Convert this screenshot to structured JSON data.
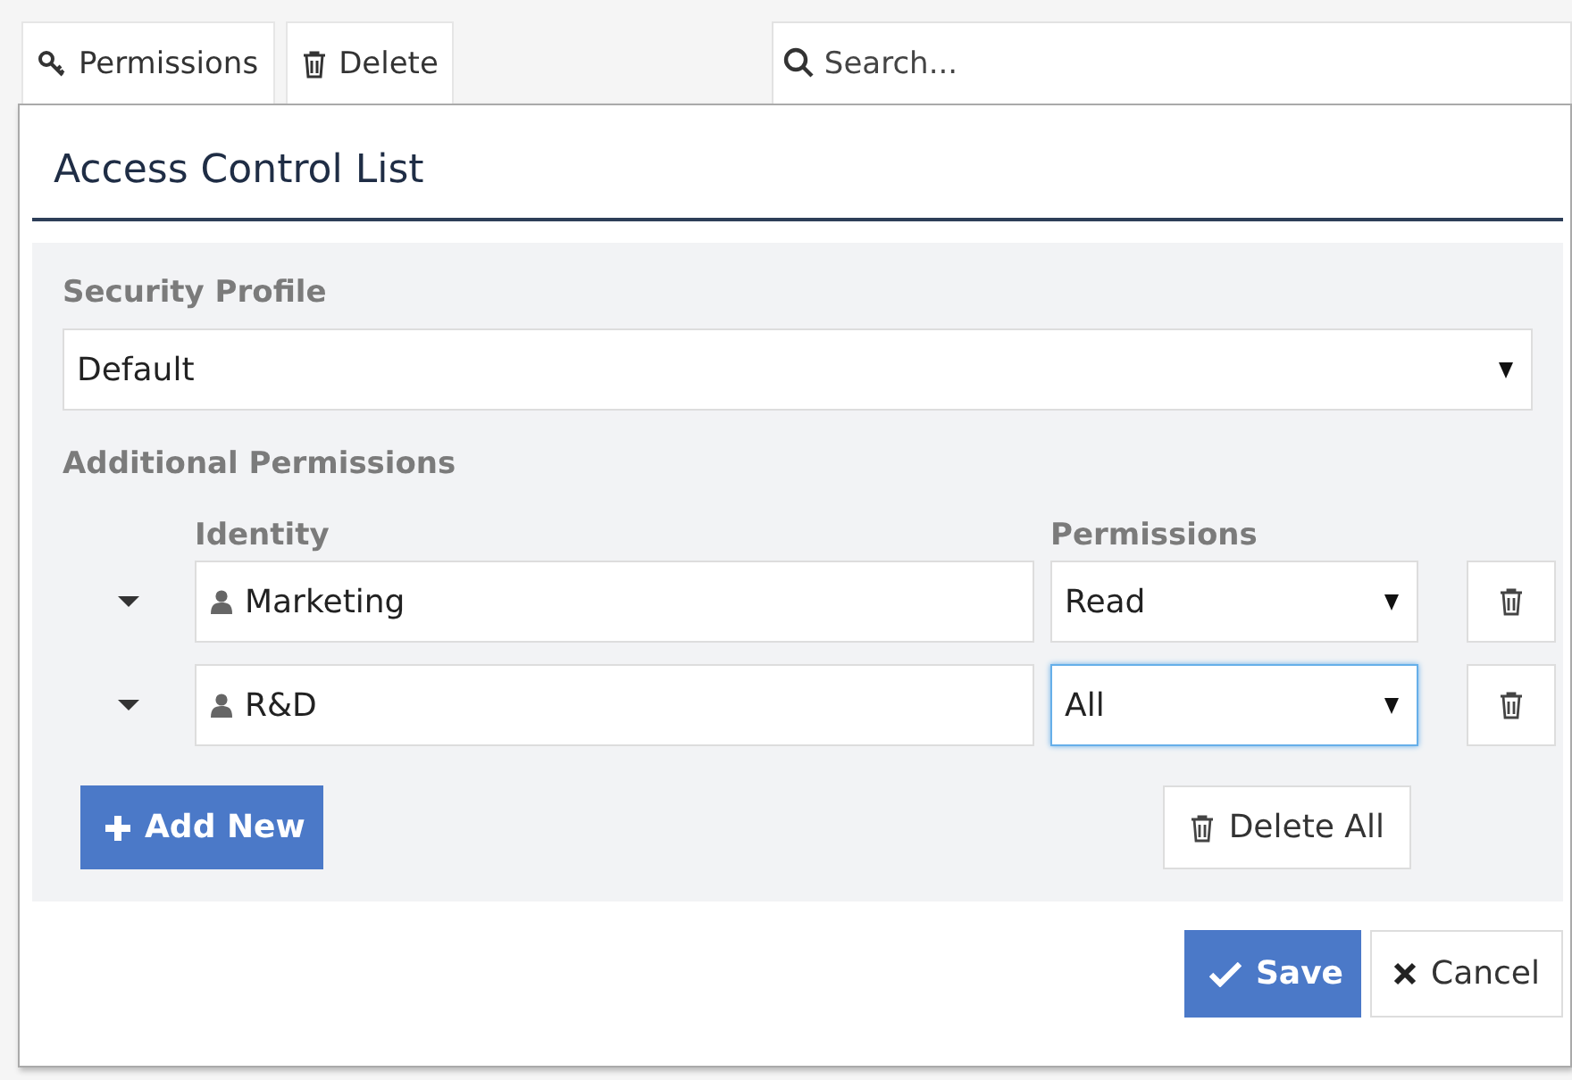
{
  "toolbar": {
    "buttons": [
      {
        "label": "Permissions",
        "kind": "key"
      },
      {
        "label": "Delete",
        "kind": "trash"
      }
    ],
    "search": {
      "placeholder": "Search..."
    }
  },
  "dialog": {
    "title": "Access Control List",
    "security_profile": {
      "label": "Security Profile",
      "value": "Default"
    },
    "additional_permissions": {
      "label": "Additional Permissions",
      "columns": [
        "Identity",
        "Permissions"
      ],
      "rows": [
        {
          "identity": "Marketing",
          "permission": "Read",
          "focused": false
        },
        {
          "identity": "R&D",
          "permission": "All",
          "focused": true
        }
      ]
    },
    "add_button": "Add New",
    "delete_all_button": "Delete All",
    "footer": {
      "save": "Save",
      "cancel": "Cancel"
    }
  }
}
